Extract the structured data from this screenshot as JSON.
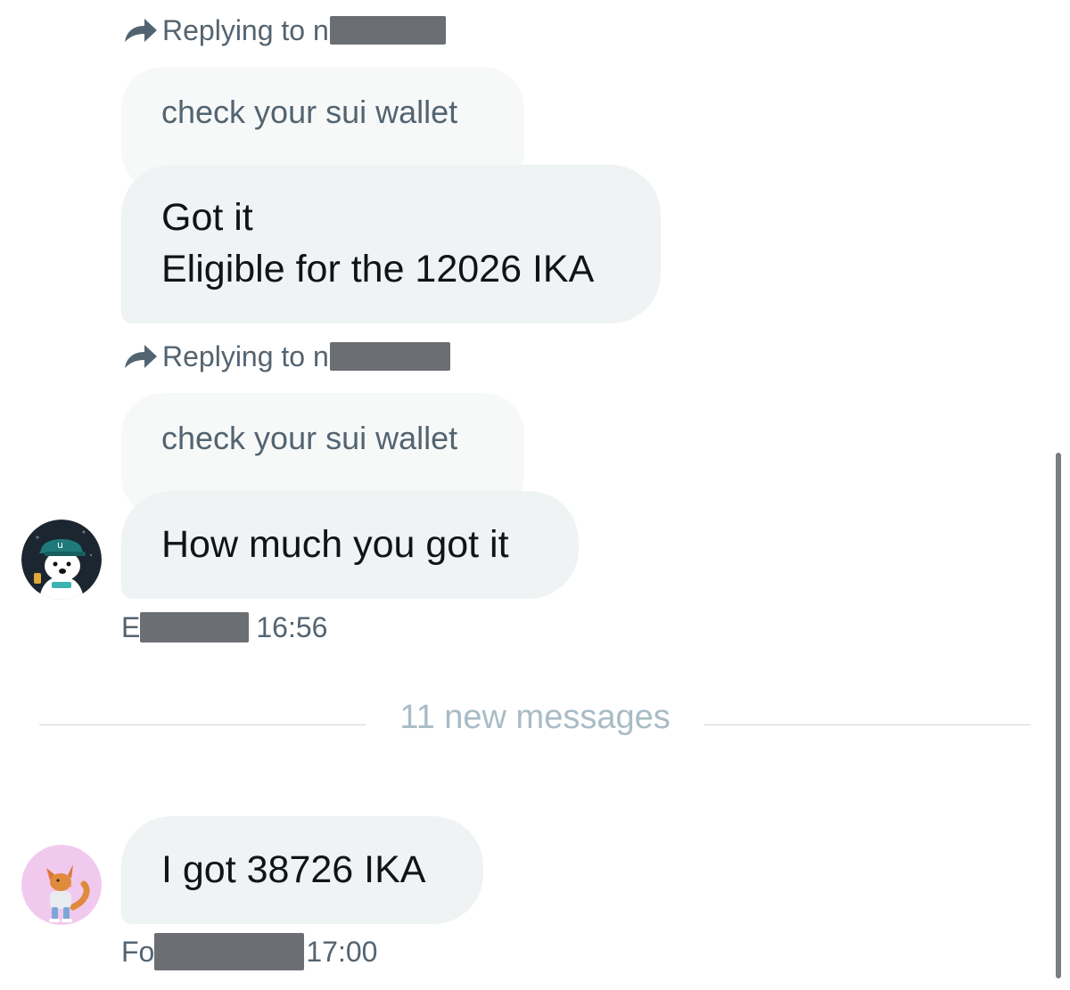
{
  "messages": [
    {
      "replying_to": "Replying to n",
      "quoted_text": "check your sui wallet",
      "body_line1": "Got it",
      "body_line2": "Eligible for the 12026 IKA"
    },
    {
      "replying_to": "Replying to n",
      "quoted_text": "check your sui wallet",
      "body": "How much you got it",
      "sender_prefix": "E",
      "time": "16:56"
    },
    {
      "body": "I got 38726 IKA",
      "sender_prefix": "Fo",
      "time": "17:00"
    }
  ],
  "divider": {
    "label": "11 new messages"
  },
  "icons": {
    "reply": "reply-arrow-icon",
    "avatar1": "dog-avatar",
    "avatar2": "fox-avatar"
  },
  "colors": {
    "bubble": "#eff3f4",
    "quoted_bubble": "#f7f9f9",
    "secondary_text": "#536471",
    "divider_text": "#a9bcc6",
    "redaction": "#6b6e72"
  }
}
